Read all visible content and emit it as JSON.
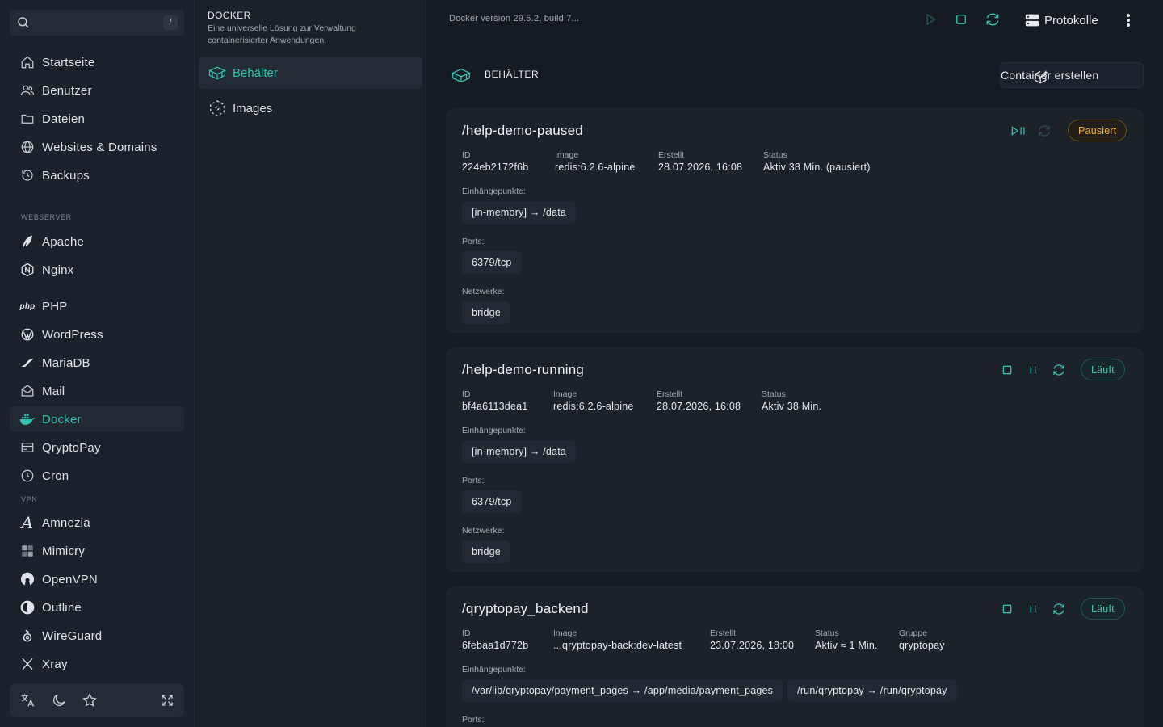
{
  "search": {
    "value": "",
    "placeholder": "",
    "shortcut": "/"
  },
  "sidebar": {
    "items": [
      {
        "label": "Startseite",
        "icon": "home-icon"
      },
      {
        "label": "Benutzer",
        "icon": "users-icon"
      },
      {
        "label": "Dateien",
        "icon": "folder-icon"
      },
      {
        "label": "Websites & Domains",
        "icon": "globe-icon"
      },
      {
        "label": "Backups",
        "icon": "history-icon"
      }
    ],
    "webserver_label": "WEBSERVER",
    "webserver": [
      {
        "label": "Apache",
        "icon": "feather-icon"
      },
      {
        "label": "Nginx",
        "icon": "nginx-icon"
      }
    ],
    "apps": [
      {
        "label": "PHP",
        "icon": "php-icon"
      },
      {
        "label": "WordPress",
        "icon": "wordpress-icon"
      },
      {
        "label": "MariaDB",
        "icon": "mariadb-icon"
      },
      {
        "label": "Mail",
        "icon": "mail-icon"
      },
      {
        "label": "Docker",
        "icon": "docker-icon"
      },
      {
        "label": "QryptoPay",
        "icon": "card-icon"
      },
      {
        "label": "Cron",
        "icon": "clock-icon"
      }
    ],
    "vpn_label": "VPN",
    "vpn": [
      {
        "label": "Amnezia",
        "icon": "amnezia-icon"
      },
      {
        "label": "Mimicry",
        "icon": "mimicry-icon"
      },
      {
        "label": "OpenVPN",
        "icon": "openvpn-icon"
      },
      {
        "label": "Outline",
        "icon": "outline-icon"
      },
      {
        "label": "WireGuard",
        "icon": "wireguard-icon"
      },
      {
        "label": "Xray",
        "icon": "xray-icon"
      }
    ],
    "active": "Docker"
  },
  "subnav": {
    "title": "DOCKER",
    "description": "Eine universelle Lösung zur Verwaltung containerisierter Anwendungen.",
    "items": [
      {
        "label": "Behälter",
        "icon": "container-icon"
      },
      {
        "label": "Images",
        "icon": "image-icon"
      }
    ]
  },
  "topbar": {
    "version": "Docker version 29.5.2, build 7...",
    "logs_label": "Protokolle"
  },
  "main": {
    "heading": "BEHÄLTER",
    "create_label": "Container erstellen"
  },
  "labels": {
    "id": "ID",
    "image": "Image",
    "created": "Erstellt",
    "status": "Status",
    "group": "Gruppe",
    "mounts": "Einhängepunkte:",
    "ports": "Ports:",
    "networks": "Netzwerke:"
  },
  "containers": [
    {
      "name": "/help-demo-paused",
      "id": "224eb2172f6b",
      "image": "redis:6.2.6-alpine",
      "created": "28.07.2026, 16:08",
      "status": "Aktiv 38 Min. (pausiert)",
      "state": "Pausiert",
      "mounts": [
        "[in-memory] → /data"
      ],
      "ports": [
        "6379/tcp"
      ],
      "networks": [
        "bridge"
      ]
    },
    {
      "name": "/help-demo-running",
      "id": "bf4a6113dea1",
      "image": "redis:6.2.6-alpine",
      "created": "28.07.2026, 16:08",
      "status": "Aktiv 38 Min.",
      "state": "Läuft",
      "mounts": [
        "[in-memory] → /data"
      ],
      "ports": [
        "6379/tcp"
      ],
      "networks": [
        "bridge"
      ]
    },
    {
      "name": "/qryptopay_backend",
      "id": "6febaa1d772b",
      "image": "...qryptopay-back:dev-latest",
      "created": "23.07.2026, 18:00",
      "status": "Aktiv ≈ 1 Min.",
      "group": "qryptopay",
      "state": "Läuft",
      "mounts": [
        "/var/lib/qryptopay/payment_pages → /app/media/payment_pages",
        "/run/qryptopay → /run/qryptopay"
      ]
    }
  ],
  "colors": {
    "accent": "#35c2b0",
    "paused": "#f0b43a",
    "bg": "#151b23"
  }
}
